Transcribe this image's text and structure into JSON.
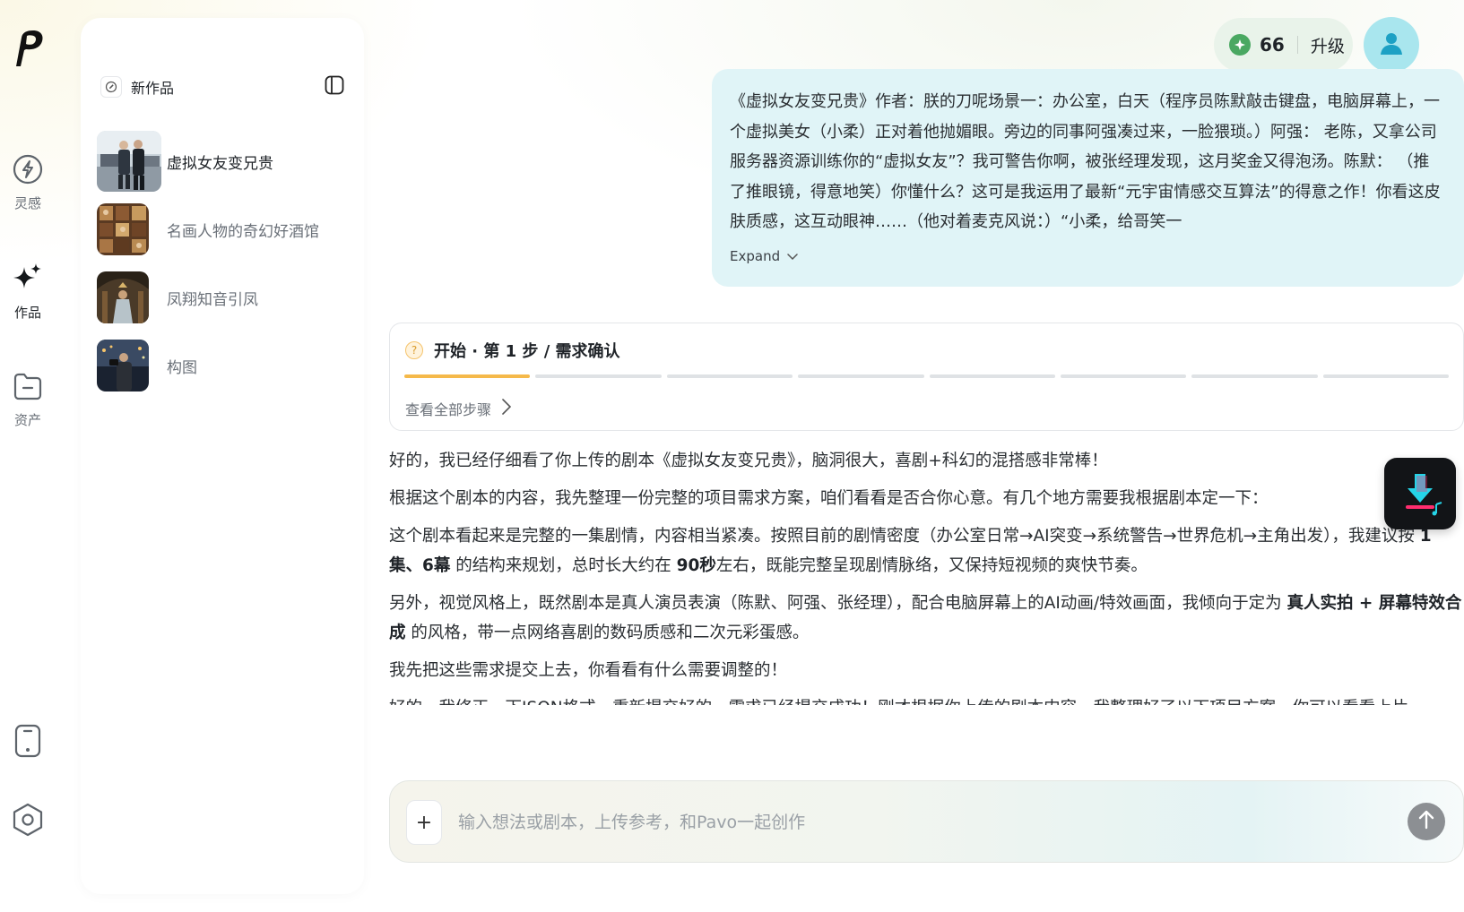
{
  "rail": {
    "items": [
      {
        "label": "灵感"
      },
      {
        "label": "作品"
      },
      {
        "label": "资产"
      }
    ]
  },
  "sidebar": {
    "new_work_label": "新作品",
    "works": [
      {
        "title": "虚拟女友变兄贵"
      },
      {
        "title": "名画人物的奇幻好酒馆"
      },
      {
        "title": "凤翔知音引凤"
      },
      {
        "title": "构图"
      }
    ]
  },
  "header": {
    "credits": "66",
    "upgrade_label": "升级"
  },
  "user_message": {
    "text": "《虚拟女友变兄贵》作者：朕的刀呢场景一：办公室，白天（程序员陈默敲击键盘，电脑屏幕上，一个虚拟美女（小柔）正对着他抛媚眼。旁边的同事阿强凑过来，一脸猥琐。）阿强： 老陈，又拿公司服务器资源训练你的“虚拟女友”？我可警告你啊，被张经理发现，这月奖金又得泡汤。陈默： （推了推眼镜，得意地笑）你懂什么？这可是我运用了最新“元宇宙情感交互算法”的得意之作！你看这皮肤质感，这互动眼神……（他对着麦克风说：）“小柔，给哥笑一",
    "expand_label": "Expand"
  },
  "step": {
    "title": "开始 · 第 1 步 / 需求确认",
    "total_steps": 8,
    "current_step": 1,
    "view_all_label": "查看全部步骤"
  },
  "reply": {
    "p1": "好的，我已经仔细看了你上传的剧本《虚拟女友变兄贵》，脑洞很大，喜剧+科幻的混搭感非常棒！",
    "p2": "根据这个剧本的内容，我先整理一份完整的项目需求方案，咱们看看是否合你心意。有几个地方需要我根据剧本定一下：",
    "p3a": "这个剧本看起来是完整的一集剧情，内容相当紧凑。按照目前的剧情密度（办公室日常→AI突变→系统警告→世界危机→主角出发），我建议按 ",
    "p3b": "1集、6幕",
    "p3c": " 的结构来规划，总时长大约在 ",
    "p3d": "90秒",
    "p3e": "左右，既能完整呈现剧情脉络，又保持短视频的爽快节奏。",
    "p4a": "另外，视觉风格上，既然剧本是真人演员表演（陈默、阿强、张经理），配合电脑屏幕上的AI动画/特效画面，我倾向于定为 ",
    "p4b": "真人实拍 + 屏幕特效合成",
    "p4c": " 的风格，带一点网络喜剧的数码质感和二次元彩蛋感。",
    "p5": "我先把这些需求提交上去，你看看有什么需要调整的！",
    "p6": "好的，我修正一下JSON格式，重新提交好的。需求已经提交成功！刚才根据你上传的剧本内容，我整理好了以下项目方案，你可以看看上片"
  },
  "composer": {
    "placeholder": "输入想法或剧本，上传参考，和Pavo一起创作"
  },
  "colors": {
    "accent_progress": "#f5b94a",
    "user_bubble": "#e0f4f7",
    "avatar": "#a9e6ee",
    "credits_bg": "#e9f3ea"
  }
}
